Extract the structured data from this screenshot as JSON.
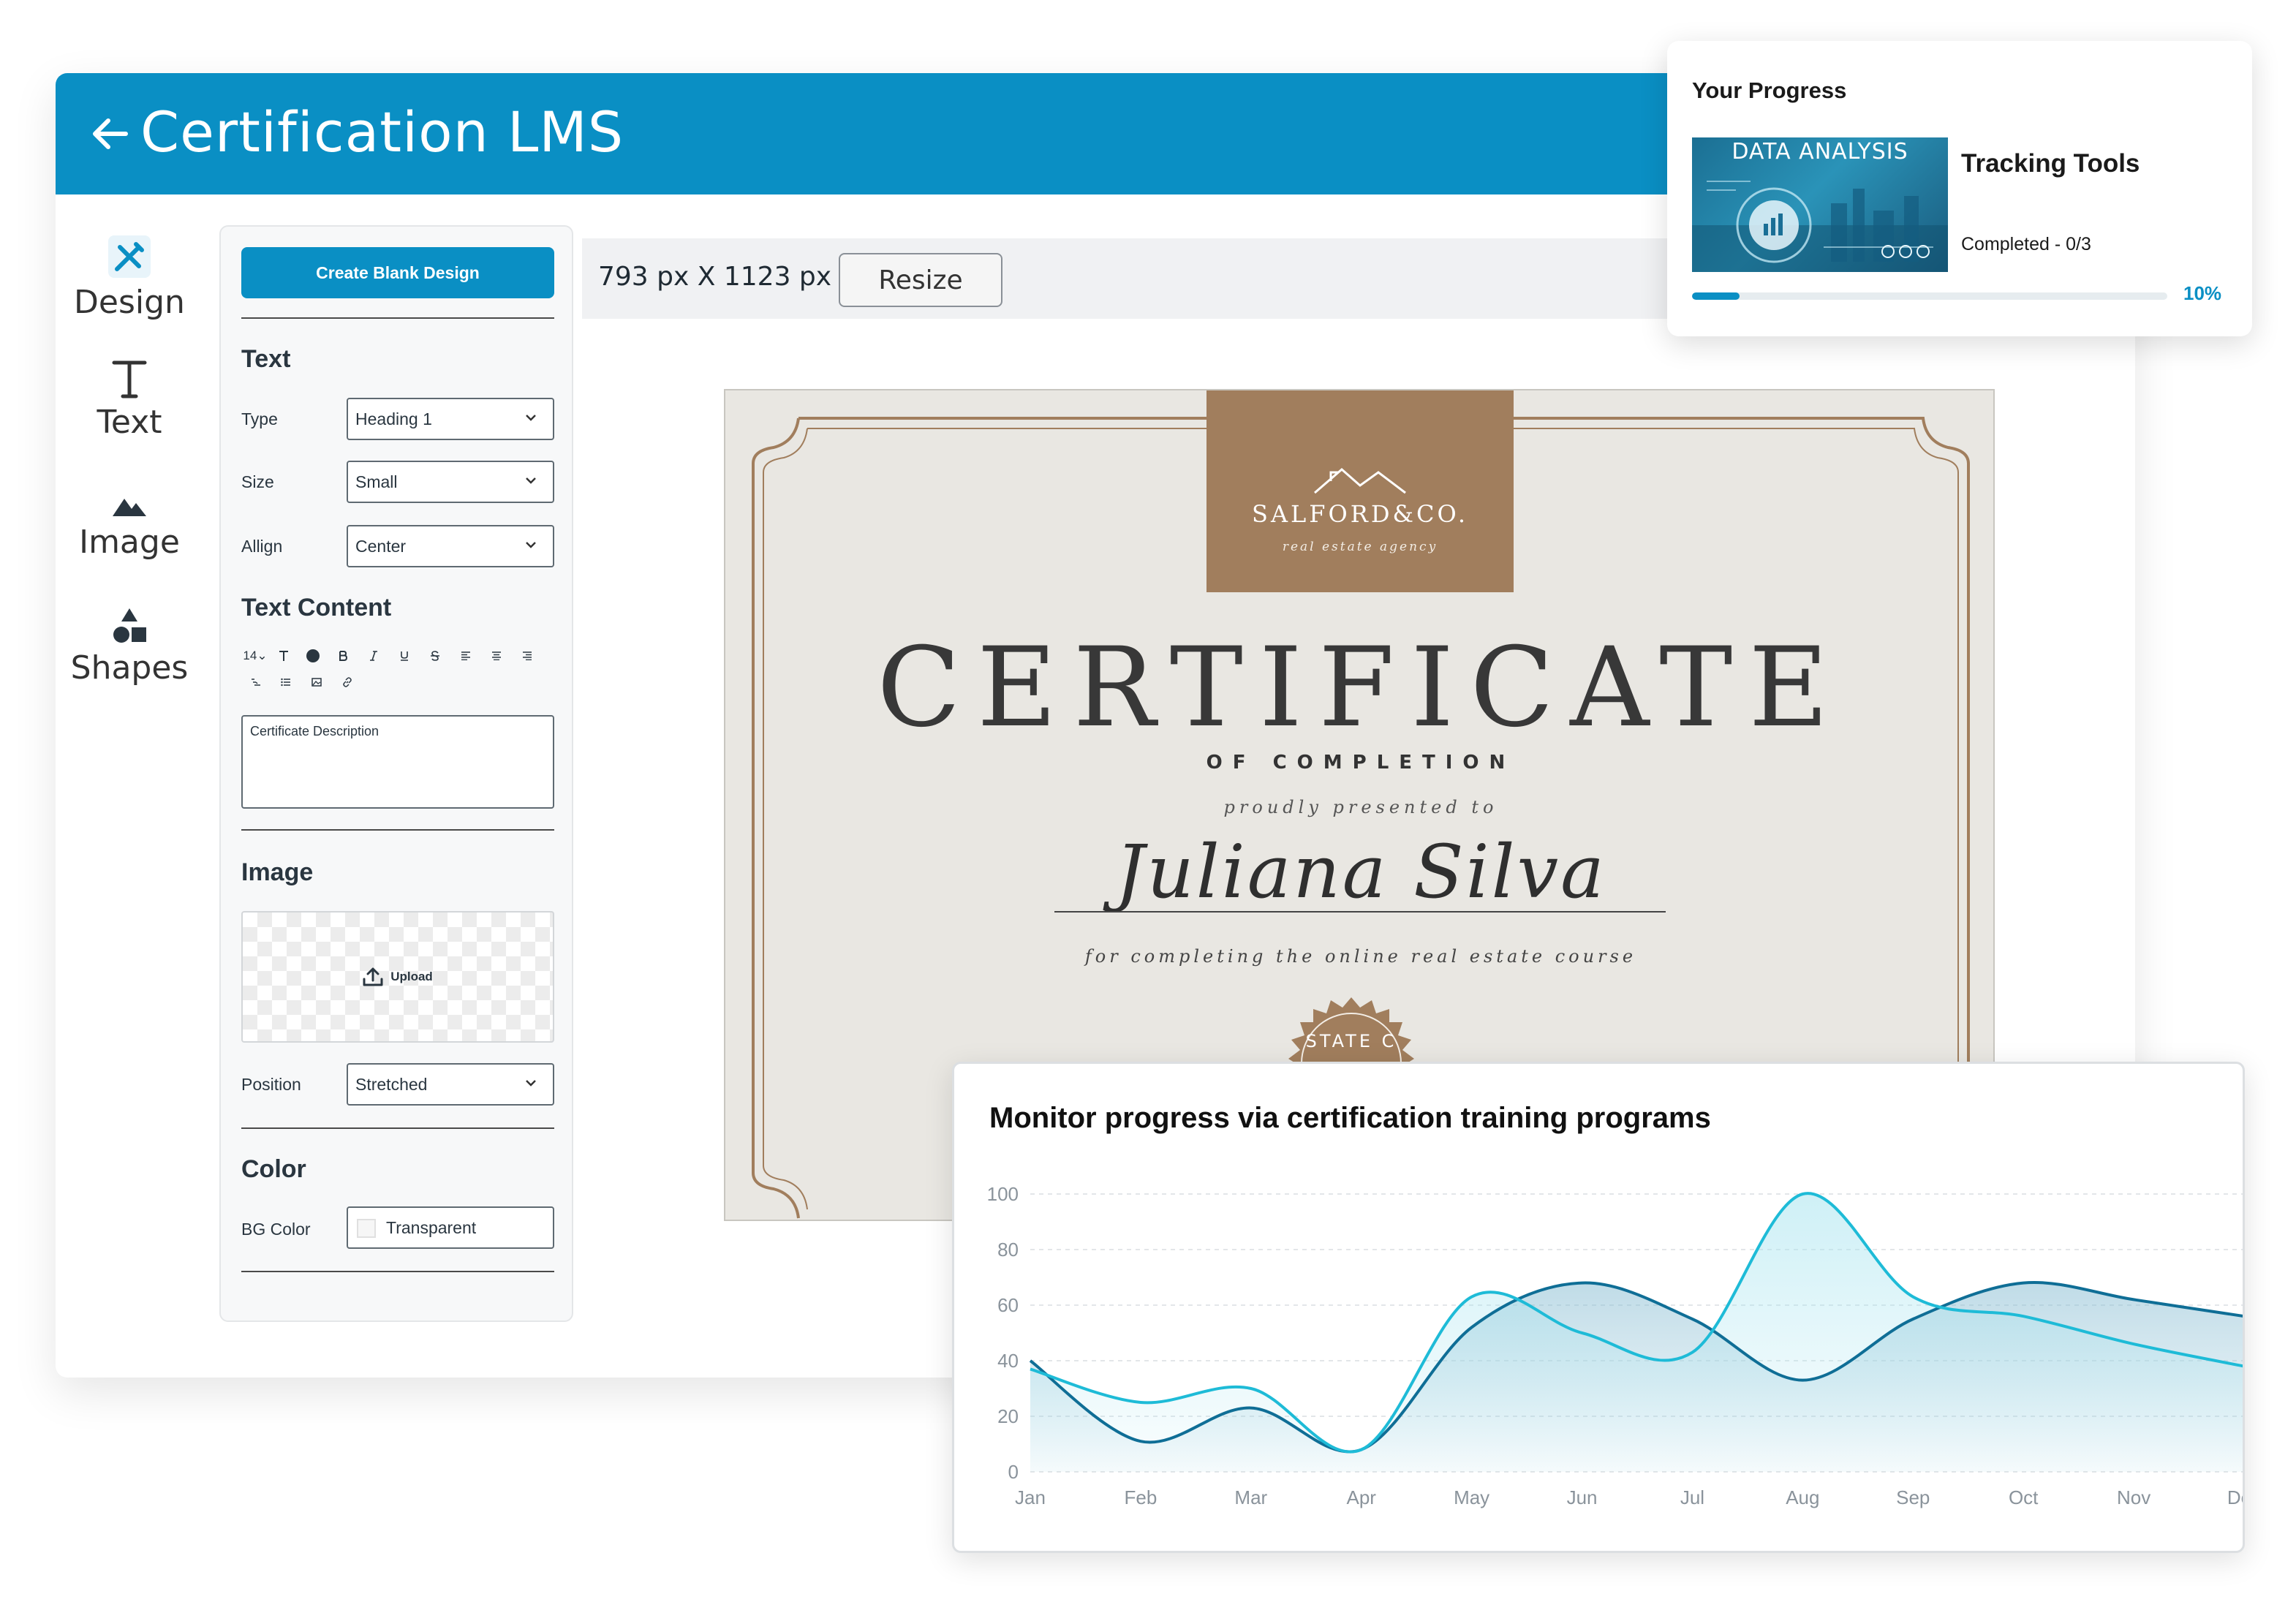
{
  "header": {
    "title": "Certification LMS"
  },
  "rail": [
    {
      "label": "Design",
      "icon": "design-icon"
    },
    {
      "label": "Text",
      "icon": "text-icon"
    },
    {
      "label": "Image",
      "icon": "image-icon"
    },
    {
      "label": "Shapes",
      "icon": "shapes-icon"
    }
  ],
  "panel": {
    "create_button": "Create Blank Design",
    "text_section": "Text",
    "type_label": "Type",
    "type_value": "Heading 1",
    "size_label": "Size",
    "size_value": "Small",
    "align_label": "Allign",
    "align_value": "Center",
    "content_section": "Text Content",
    "font_size": "14",
    "content_placeholder": "Certificate Description",
    "image_section": "Image",
    "upload_label": "Upload",
    "position_label": "Position",
    "position_value": "Stretched",
    "color_section": "Color",
    "bg_label": "BG Color",
    "bg_value": "Transparent"
  },
  "canvas": {
    "dimensions": "793 px X 1123 px",
    "resize_button": "Resize"
  },
  "certificate": {
    "company": "SALFORD&CO.",
    "company_sub": "real estate agency",
    "title": "CERTIFICATE",
    "subtitle": "OF COMPLETION",
    "presented": "proudly presented to",
    "recipient": "Juliana Silva",
    "for_text": "for completing the online real estate course",
    "seal_text": "STATE C"
  },
  "progress": {
    "title": "Your Progress",
    "thumbnail_label": "DATA ANALYSIS",
    "course": "Tracking Tools",
    "completed": "Completed - 0/3",
    "percent_label": "10%",
    "percent": 0.1,
    "accent": "#0a8fc4"
  },
  "chart_data": {
    "type": "area",
    "title": "Monitor progress via certification training programs",
    "categories": [
      "Jan",
      "Feb",
      "Mar",
      "Apr",
      "May",
      "Jun",
      "Jul",
      "Aug",
      "Sep",
      "Oct",
      "Nov",
      "Dec"
    ],
    "y_ticks": [
      0,
      20,
      40,
      60,
      80,
      100
    ],
    "ylim": [
      0,
      100
    ],
    "grid": true,
    "series": [
      {
        "values": [
          40,
          11,
          23,
          8,
          52,
          68,
          55,
          33,
          55,
          68,
          62,
          56
        ],
        "color": "#0f6e96",
        "fill": "#8cbfd4"
      },
      {
        "values": [
          37,
          25,
          30,
          8,
          63,
          50,
          43,
          100,
          63,
          56,
          46,
          38
        ],
        "color": "#1ebbd7",
        "fill": "#a7e4ef"
      }
    ]
  }
}
